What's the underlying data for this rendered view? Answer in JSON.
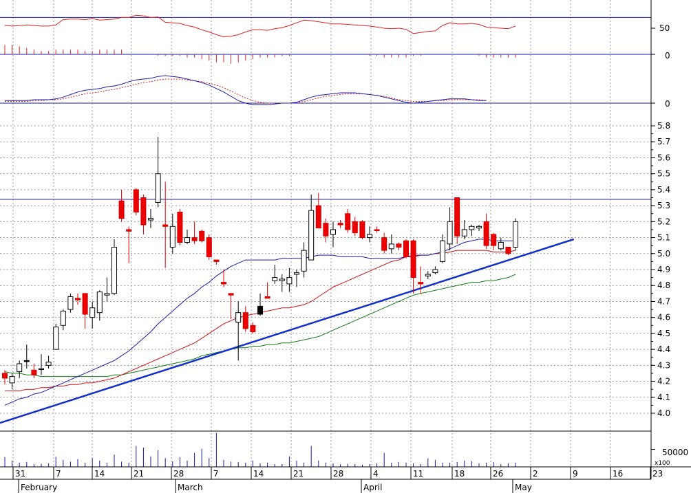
{
  "chart_data": {
    "type": "candlestick",
    "x_axis": {
      "day_labels": [
        "31",
        "7",
        "14",
        "21",
        "28",
        "7",
        "14",
        "21",
        "28",
        "4",
        "11",
        "18",
        "26",
        "2",
        "9",
        "16",
        "23"
      ],
      "month_labels": [
        "February",
        "March",
        "April",
        "May"
      ]
    },
    "price_panel": {
      "y_ticks": [
        "5.8",
        "5.7",
        "5.6",
        "5.5",
        "5.4",
        "5.3",
        "5.2",
        "5.1",
        "5.0",
        "4.9",
        "4.8",
        "4.7",
        "4.6",
        "4.5",
        "4.4",
        "4.3",
        "4.2",
        "4.1",
        "4.0"
      ],
      "ylim": [
        3.92,
        5.85
      ],
      "resistance_level": 5.34,
      "candles": [
        {
          "o": 4.25,
          "h": 4.27,
          "l": 4.18,
          "c": 4.22,
          "bull": false
        },
        {
          "o": 4.19,
          "h": 4.25,
          "l": 4.15,
          "c": 4.23,
          "bull": true
        },
        {
          "o": 4.26,
          "h": 4.33,
          "l": 4.22,
          "c": 4.31,
          "bull": true
        },
        {
          "o": 4.33,
          "h": 4.43,
          "l": 4.28,
          "c": 4.33,
          "bull": false
        },
        {
          "o": 4.27,
          "h": 4.31,
          "l": 4.22,
          "c": 4.24,
          "bull": false
        },
        {
          "o": 4.28,
          "h": 4.37,
          "l": 4.24,
          "c": 4.28,
          "bull": true
        },
        {
          "o": 4.3,
          "h": 4.36,
          "l": 4.28,
          "c": 4.32,
          "bull": true
        },
        {
          "o": 4.4,
          "h": 4.56,
          "l": 4.4,
          "c": 4.54,
          "bull": true
        },
        {
          "o": 4.55,
          "h": 4.65,
          "l": 4.52,
          "c": 4.64,
          "bull": true
        },
        {
          "o": 4.65,
          "h": 4.75,
          "l": 4.63,
          "c": 4.73,
          "bull": true
        },
        {
          "o": 4.72,
          "h": 4.75,
          "l": 4.68,
          "c": 4.71,
          "bull": false
        },
        {
          "o": 4.75,
          "h": 4.75,
          "l": 4.53,
          "c": 4.62,
          "bull": false
        },
        {
          "o": 4.6,
          "h": 4.7,
          "l": 4.53,
          "c": 4.66,
          "bull": true
        },
        {
          "o": 4.63,
          "h": 4.77,
          "l": 4.58,
          "c": 4.76,
          "bull": true
        },
        {
          "o": 4.74,
          "h": 4.85,
          "l": 4.7,
          "c": 4.75,
          "bull": true
        },
        {
          "o": 4.75,
          "h": 5.09,
          "l": 4.74,
          "c": 5.04,
          "bull": true
        },
        {
          "o": 5.33,
          "h": 5.4,
          "l": 5.2,
          "c": 5.22,
          "bull": false
        },
        {
          "o": 5.15,
          "h": 5.17,
          "l": 4.94,
          "c": 5.14,
          "bull": false
        },
        {
          "o": 5.4,
          "h": 5.41,
          "l": 5.24,
          "c": 5.26,
          "bull": false
        },
        {
          "o": 5.35,
          "h": 5.37,
          "l": 5.12,
          "c": 5.18,
          "bull": false
        },
        {
          "o": 5.21,
          "h": 5.28,
          "l": 5.16,
          "c": 5.22,
          "bull": true
        },
        {
          "o": 5.32,
          "h": 5.73,
          "l": 5.29,
          "c": 5.5,
          "bull": true
        },
        {
          "o": 5.18,
          "h": 5.45,
          "l": 4.91,
          "c": 5.17,
          "bull": false
        },
        {
          "o": 5.04,
          "h": 5.25,
          "l": 5.0,
          "c": 5.17,
          "bull": true
        },
        {
          "o": 5.26,
          "h": 5.28,
          "l": 5.05,
          "c": 5.07,
          "bull": false
        },
        {
          "o": 5.07,
          "h": 5.15,
          "l": 5.06,
          "c": 5.1,
          "bull": true
        },
        {
          "o": 5.08,
          "h": 5.2,
          "l": 5.06,
          "c": 5.1,
          "bull": false
        },
        {
          "o": 5.14,
          "h": 5.15,
          "l": 5.07,
          "c": 5.08,
          "bull": false
        },
        {
          "o": 5.1,
          "h": 5.12,
          "l": 4.96,
          "c": 4.98,
          "bull": false
        },
        {
          "o": 4.96,
          "h": 4.96,
          "l": 4.93,
          "c": 4.95,
          "bull": false
        },
        {
          "o": 4.82,
          "h": 4.9,
          "l": 4.79,
          "c": 4.81,
          "bull": false
        },
        {
          "o": 4.75,
          "h": 4.75,
          "l": 4.59,
          "c": 4.74,
          "bull": false
        },
        {
          "o": 4.57,
          "h": 4.7,
          "l": 4.33,
          "c": 4.63,
          "bull": true
        },
        {
          "o": 4.63,
          "h": 4.67,
          "l": 4.51,
          "c": 4.53,
          "bull": false
        },
        {
          "o": 4.55,
          "h": 4.57,
          "l": 4.5,
          "c": 4.51,
          "bull": false
        },
        {
          "o": 4.62,
          "h": 4.75,
          "l": 4.61,
          "c": 4.67,
          "bull": false
        },
        {
          "o": 4.73,
          "h": 4.82,
          "l": 4.72,
          "c": 4.72,
          "bull": false
        },
        {
          "o": 4.85,
          "h": 4.93,
          "l": 4.81,
          "c": 4.83,
          "bull": true
        },
        {
          "o": 4.83,
          "h": 4.87,
          "l": 4.76,
          "c": 4.84,
          "bull": true
        },
        {
          "o": 4.81,
          "h": 4.91,
          "l": 4.76,
          "c": 4.85,
          "bull": true
        },
        {
          "o": 4.87,
          "h": 4.9,
          "l": 4.79,
          "c": 4.88,
          "bull": true
        },
        {
          "o": 4.89,
          "h": 5.07,
          "l": 4.85,
          "c": 5.02,
          "bull": true
        },
        {
          "o": 4.96,
          "h": 5.37,
          "l": 4.96,
          "c": 5.27,
          "bull": true
        },
        {
          "o": 5.3,
          "h": 5.38,
          "l": 5.16,
          "c": 5.16,
          "bull": false
        },
        {
          "o": 5.19,
          "h": 5.22,
          "l": 5.07,
          "c": 5.11,
          "bull": false
        },
        {
          "o": 5.12,
          "h": 5.2,
          "l": 5.04,
          "c": 5.15,
          "bull": true
        },
        {
          "o": 5.19,
          "h": 5.21,
          "l": 5.16,
          "c": 5.18,
          "bull": false
        },
        {
          "o": 5.25,
          "h": 5.28,
          "l": 5.13,
          "c": 5.15,
          "bull": false
        },
        {
          "o": 5.2,
          "h": 5.23,
          "l": 5.11,
          "c": 5.13,
          "bull": false
        },
        {
          "o": 5.2,
          "h": 5.21,
          "l": 5.09,
          "c": 5.1,
          "bull": false
        },
        {
          "o": 5.1,
          "h": 5.17,
          "l": 5.07,
          "c": 5.12,
          "bull": true
        },
        {
          "o": 5.15,
          "h": 5.17,
          "l": 5.13,
          "c": 5.15,
          "bull": false
        },
        {
          "o": 5.1,
          "h": 5.13,
          "l": 5.0,
          "c": 5.02,
          "bull": false
        },
        {
          "o": 5.03,
          "h": 5.12,
          "l": 5.0,
          "c": 5.06,
          "bull": true
        },
        {
          "o": 5.06,
          "h": 5.07,
          "l": 5.02,
          "c": 5.04,
          "bull": false
        },
        {
          "o": 5.08,
          "h": 5.09,
          "l": 4.97,
          "c": 4.98,
          "bull": false
        },
        {
          "o": 5.08,
          "h": 5.09,
          "l": 4.75,
          "c": 4.85,
          "bull": false
        },
        {
          "o": 4.82,
          "h": 4.92,
          "l": 4.75,
          "c": 4.81,
          "bull": false
        },
        {
          "o": 4.87,
          "h": 4.89,
          "l": 4.84,
          "c": 4.86,
          "bull": true
        },
        {
          "o": 4.88,
          "h": 4.92,
          "l": 4.87,
          "c": 4.9,
          "bull": true
        },
        {
          "o": 4.95,
          "h": 5.12,
          "l": 4.94,
          "c": 5.08,
          "bull": true
        },
        {
          "o": 5.06,
          "h": 5.29,
          "l": 5.02,
          "c": 5.2,
          "bull": true
        },
        {
          "o": 5.35,
          "h": 5.35,
          "l": 5.06,
          "c": 5.11,
          "bull": false
        },
        {
          "o": 5.11,
          "h": 5.21,
          "l": 5.09,
          "c": 5.15,
          "bull": true
        },
        {
          "o": 5.15,
          "h": 5.18,
          "l": 5.11,
          "c": 5.17,
          "bull": true
        },
        {
          "o": 5.16,
          "h": 5.18,
          "l": 5.14,
          "c": 5.17,
          "bull": true
        },
        {
          "o": 5.2,
          "h": 5.25,
          "l": 5.03,
          "c": 5.05,
          "bull": false
        },
        {
          "o": 5.12,
          "h": 5.13,
          "l": 5.02,
          "c": 5.05,
          "bull": false
        },
        {
          "o": 5.03,
          "h": 5.1,
          "l": 5.02,
          "c": 5.07,
          "bull": true
        },
        {
          "o": 5.04,
          "h": 5.04,
          "l": 4.99,
          "c": 5.0,
          "bull": false
        },
        {
          "o": 5.04,
          "h": 5.22,
          "l": 5.02,
          "c": 5.2,
          "bull": true
        }
      ],
      "moving_average_blue": [
        4.05,
        4.07,
        4.09,
        4.1,
        4.12,
        4.13,
        4.15,
        4.17,
        4.19,
        4.21,
        4.23,
        4.25,
        4.27,
        4.29,
        4.31,
        4.33,
        4.36,
        4.39,
        4.43,
        4.47,
        4.51,
        4.56,
        4.6,
        4.64,
        4.68,
        4.72,
        4.75,
        4.79,
        4.82,
        4.86,
        4.89,
        4.92,
        4.94,
        4.96,
        4.96,
        4.96,
        4.96,
        4.96,
        4.97,
        4.97,
        4.97,
        4.97,
        4.98,
        4.99,
        4.99,
        4.99,
        4.98,
        4.98,
        4.98,
        4.98,
        4.97,
        4.97,
        4.97,
        4.97,
        4.97,
        4.98,
        4.98,
        4.99,
        4.99,
        5.0,
        5.01,
        5.03,
        5.05,
        5.07,
        5.08,
        5.09,
        5.09,
        5.08,
        5.08,
        5.08,
        5.08
      ],
      "moving_average_red": [
        4.14,
        4.14,
        4.14,
        4.15,
        4.15,
        4.16,
        4.16,
        4.17,
        4.17,
        4.18,
        4.18,
        4.19,
        4.19,
        4.2,
        4.21,
        4.22,
        4.24,
        4.26,
        4.28,
        4.3,
        4.32,
        4.34,
        4.36,
        4.38,
        4.4,
        4.42,
        4.44,
        4.47,
        4.5,
        4.53,
        4.56,
        4.58,
        4.6,
        4.61,
        4.62,
        4.63,
        4.64,
        4.65,
        4.66,
        4.66,
        4.67,
        4.68,
        4.7,
        4.73,
        4.76,
        4.79,
        4.81,
        4.83,
        4.85,
        4.87,
        4.89,
        4.91,
        4.93,
        4.95,
        4.96,
        4.98,
        4.99,
        4.99,
        4.99,
        5.0,
        5.0,
        5.01,
        5.02,
        5.02,
        5.02,
        5.02,
        5.02,
        5.01,
        5.01,
        5.01,
        5.02
      ],
      "moving_average_green": [
        4.26,
        4.25,
        4.25,
        4.24,
        4.24,
        4.23,
        4.23,
        4.23,
        4.23,
        4.23,
        4.23,
        4.23,
        4.23,
        4.23,
        4.23,
        4.24,
        4.24,
        4.25,
        4.26,
        4.27,
        4.28,
        4.29,
        4.3,
        4.31,
        4.32,
        4.33,
        4.34,
        4.36,
        4.37,
        4.38,
        4.39,
        4.4,
        4.41,
        4.41,
        4.42,
        4.42,
        4.43,
        4.43,
        4.44,
        4.44,
        4.45,
        4.46,
        4.47,
        4.48,
        4.5,
        4.52,
        4.54,
        4.56,
        4.58,
        4.6,
        4.62,
        4.64,
        4.66,
        4.68,
        4.7,
        4.72,
        4.74,
        4.75,
        4.76,
        4.77,
        4.78,
        4.79,
        4.8,
        4.81,
        4.82,
        4.82,
        4.83,
        4.83,
        4.84,
        4.85,
        4.87
      ],
      "trendline": {
        "start": [
          -2,
          3.92
        ],
        "end": [
          78,
          5.09
        ]
      }
    },
    "rsi_panel": {
      "y_ticks": [
        "50"
      ],
      "ylim": [
        0,
        100
      ],
      "level": 70,
      "values": [
        55,
        54,
        55,
        56,
        55,
        54,
        54,
        56,
        66,
        67,
        67,
        66,
        68,
        65,
        66,
        67,
        70,
        70,
        74,
        73,
        70,
        71,
        61,
        60,
        59,
        55,
        52,
        47,
        43,
        38,
        34,
        35,
        38,
        43,
        47,
        47,
        46,
        49,
        51,
        55,
        60,
        65,
        64,
        62,
        60,
        58,
        58,
        57,
        56,
        55,
        54,
        52,
        50,
        49,
        50,
        48,
        40,
        42,
        44,
        45,
        55,
        60,
        58,
        58,
        59,
        57,
        52,
        51,
        50,
        49,
        54
      ]
    },
    "histogram_panel": {
      "y_ticks": [
        "0"
      ],
      "values": [
        0.06,
        0.06,
        0.05,
        0.04,
        0.03,
        0.02,
        0.02,
        0.03,
        0.03,
        0.03,
        0.03,
        0.02,
        0.02,
        0.03,
        0.03,
        0.03,
        0.03,
        0,
        0,
        0,
        0,
        -0.01,
        -0.01,
        -0.01,
        -0.01,
        -0.02,
        -0.02,
        -0.03,
        -0.04,
        -0.05,
        -0.05,
        -0.06,
        -0.05,
        -0.04,
        -0.03,
        -0.02,
        -0.02,
        -0.02,
        -0.01,
        -0.01,
        0,
        0,
        0,
        0,
        0,
        0,
        0,
        0,
        0,
        0,
        -0.01,
        -0.01,
        -0.02,
        -0.02,
        -0.02,
        -0.02,
        -0.01,
        -0.01,
        0,
        0,
        0,
        0,
        0,
        0,
        0,
        -0.01,
        -0.02,
        -0.02,
        -0.02,
        -0.02,
        -0.02
      ]
    },
    "macd_panel": {
      "y_ticks": [
        "0"
      ],
      "zero_level": 0,
      "ylim": [
        -0.08,
        0.45
      ],
      "macd": [
        0.03,
        0.03,
        0.03,
        0.03,
        0.04,
        0.04,
        0.04,
        0.05,
        0.07,
        0.1,
        0.13,
        0.15,
        0.16,
        0.17,
        0.19,
        0.2,
        0.22,
        0.25,
        0.27,
        0.28,
        0.29,
        0.31,
        0.32,
        0.31,
        0.3,
        0.28,
        0.26,
        0.24,
        0.21,
        0.17,
        0.13,
        0.08,
        0.03,
        0.0,
        -0.02,
        -0.02,
        -0.02,
        -0.01,
        0.0,
        0.0,
        0.01,
        0.04,
        0.07,
        0.09,
        0.1,
        0.11,
        0.12,
        0.12,
        0.12,
        0.11,
        0.1,
        0.09,
        0.07,
        0.05,
        0.03,
        0.01,
        0.0,
        0.01,
        0.02,
        0.03,
        0.04,
        0.05,
        0.05,
        0.05,
        0.04,
        0.03,
        0.03
      ],
      "signal": [
        0.02,
        0.02,
        0.02,
        0.02,
        0.03,
        0.03,
        0.04,
        0.04,
        0.05,
        0.07,
        0.09,
        0.11,
        0.12,
        0.13,
        0.15,
        0.16,
        0.18,
        0.2,
        0.22,
        0.24,
        0.25,
        0.27,
        0.28,
        0.28,
        0.28,
        0.27,
        0.26,
        0.25,
        0.23,
        0.21,
        0.18,
        0.14,
        0.1,
        0.06,
        0.03,
        0.01,
        0.0,
        0.0,
        0.0,
        0.0,
        0.01,
        0.02,
        0.04,
        0.06,
        0.08,
        0.09,
        0.1,
        0.11,
        0.11,
        0.11,
        0.1,
        0.09,
        0.08,
        0.06,
        0.04,
        0.03,
        0.02,
        0.02,
        0.02,
        0.03,
        0.03,
        0.04,
        0.04,
        0.04,
        0.04,
        0.04,
        0.03
      ]
    },
    "volume_panel": {
      "y_ticks": [
        "50000"
      ],
      "unit_label": "x100",
      "ylim": [
        0,
        100000
      ],
      "values": [
        28000,
        18000,
        12000,
        14000,
        8000,
        9000,
        10000,
        29000,
        20000,
        15000,
        22000,
        12000,
        25000,
        18000,
        12000,
        35000,
        15000,
        12000,
        60000,
        55000,
        30000,
        48000,
        25000,
        16000,
        28000,
        18000,
        40000,
        52000,
        25000,
        97000,
        20000,
        15000,
        14000,
        12000,
        18000,
        10000,
        12000,
        8000,
        8000,
        30000,
        18000,
        12000,
        60000,
        18000,
        12000,
        10000,
        8000,
        9000,
        8000,
        6000,
        8000,
        10000,
        40000,
        12000,
        14000,
        12000,
        10000,
        8000,
        24000,
        20000,
        12000,
        12000,
        14000,
        18000,
        16000,
        10000,
        12000,
        14000,
        8000,
        10000,
        12000
      ]
    }
  }
}
